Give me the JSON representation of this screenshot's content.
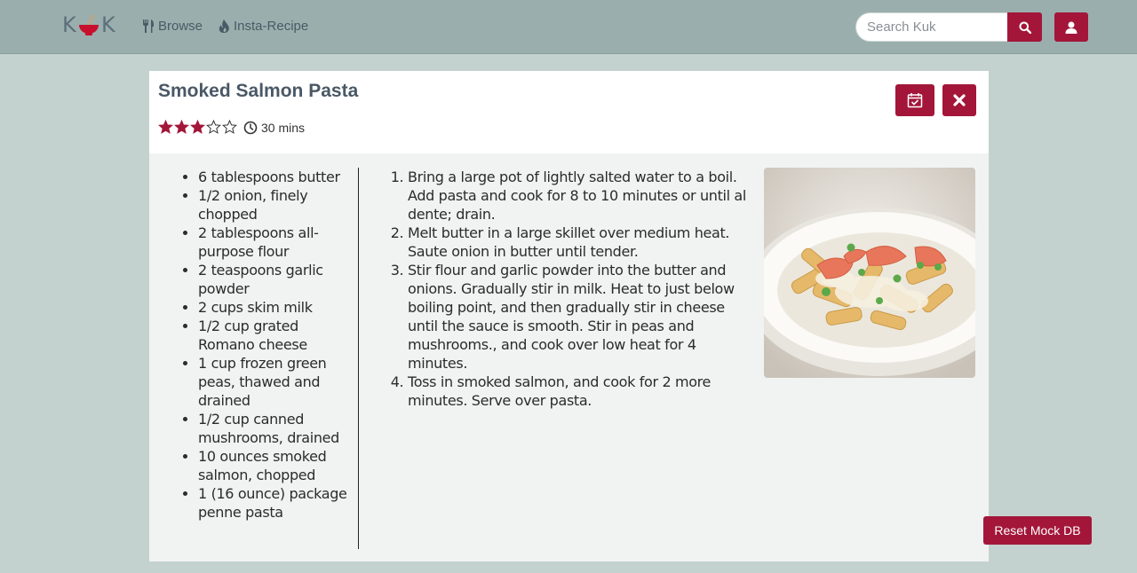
{
  "nav": {
    "logo_left": "K",
    "logo_right": "K",
    "browse_label": "Browse",
    "insta_label": "Insta-Recipe",
    "search_placeholder": "Search Kuk"
  },
  "recipe": {
    "title": "Smoked Salmon Pasta",
    "rating": 3,
    "rating_max": 5,
    "time": "30 mins",
    "ingredients": [
      "6 tablespoons butter",
      "1/2 onion, finely chopped",
      "2 tablespoons all-purpose flour",
      "2 teaspoons garlic powder",
      "2 cups skim milk",
      "1/2 cup grated Romano cheese",
      "1 cup frozen green peas, thawed and drained",
      "1/2 cup canned mushrooms, drained",
      "10 ounces smoked salmon, chopped",
      "1 (16 ounce) package penne pasta"
    ],
    "directions": [
      "Bring a large pot of lightly salted water to a boil. Add pasta and cook for 8 to 10 minutes or until al dente; drain.",
      "Melt butter in a large skillet over medium heat. Saute onion in butter until tender.",
      "Stir flour and garlic powder into the butter and onions. Gradually stir in milk. Heat to just below boiling point, and then gradually stir in cheese until the sauce is smooth. Stir in peas and mushrooms., and cook over low heat for 4 minutes.",
      "Toss in smoked salmon, and cook for 2 more minutes. Serve over pasta."
    ]
  },
  "reset_label": "Reset Mock DB",
  "colors": {
    "accent": "#a3163a",
    "navbar": "#9aafad",
    "background": "#c3d2cf",
    "title": "#4a5866"
  },
  "icons": {
    "browse": "utensils-icon",
    "insta": "flame-icon",
    "search": "search-icon",
    "user": "user-icon",
    "schedule": "calendar-check-icon",
    "close": "close-icon",
    "time": "clock-icon"
  }
}
